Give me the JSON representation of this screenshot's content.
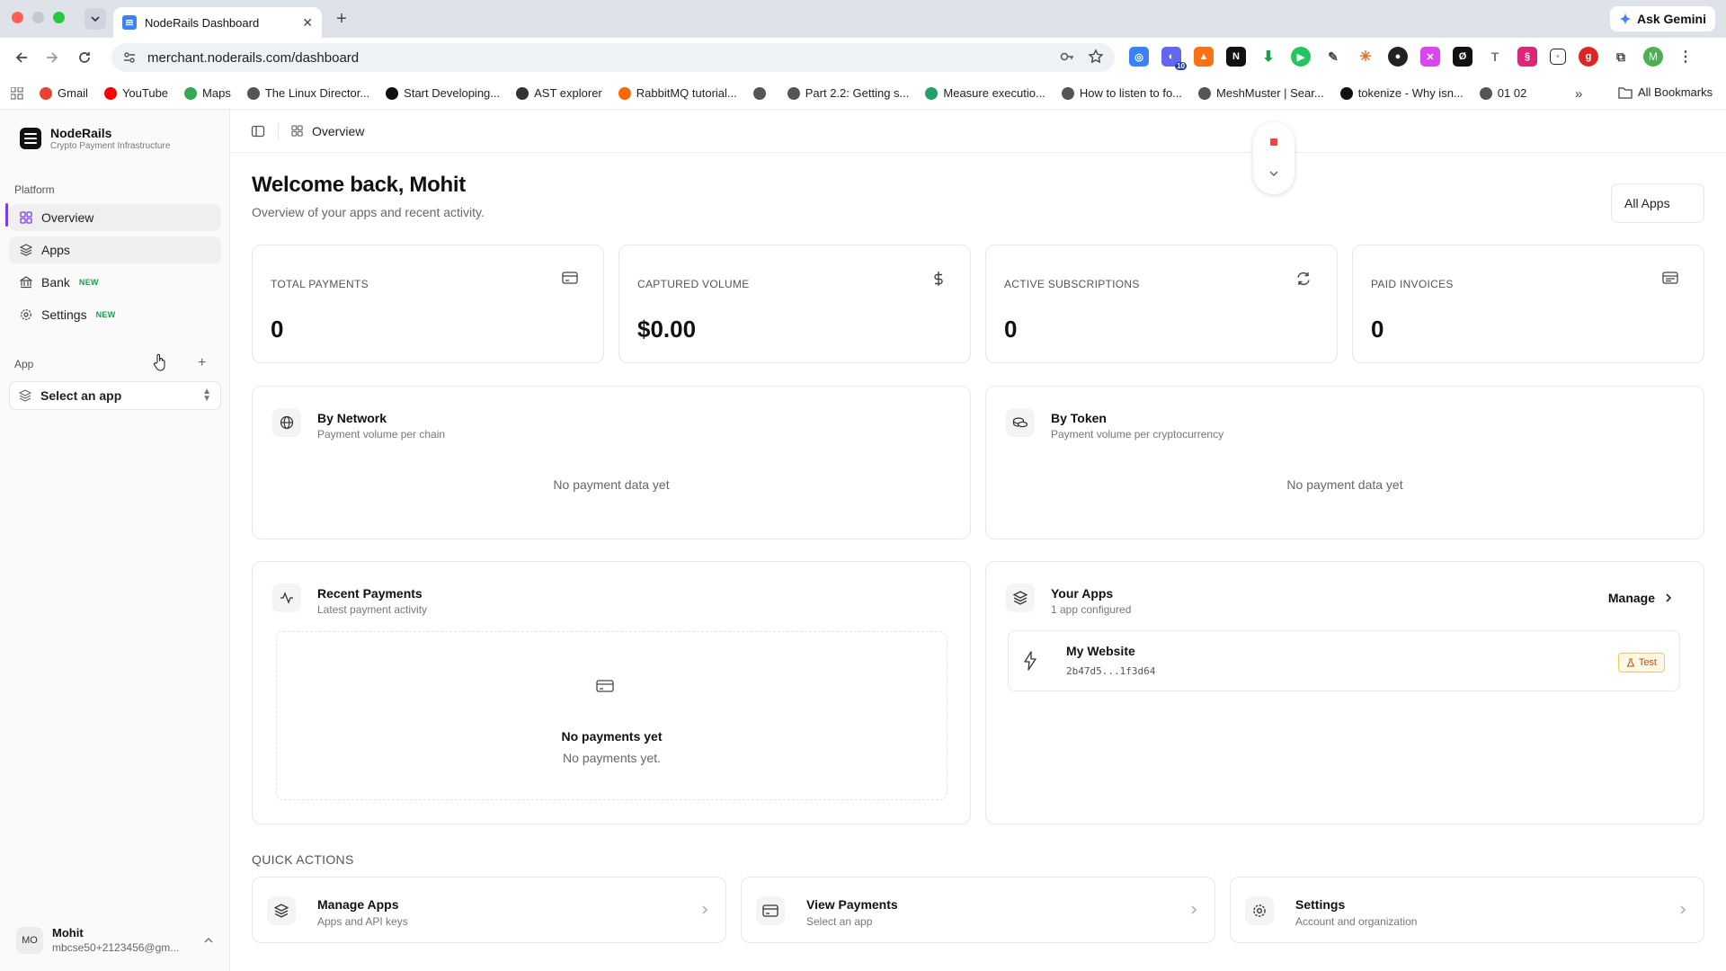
{
  "browser": {
    "tab_title": "NodeRails Dashboard",
    "url": "merchant.noderails.com/dashboard",
    "ask_gemini": "Ask Gemini",
    "profile_initial": "M",
    "bookmarks": [
      {
        "label": "Gmail",
        "color": "#ea4335"
      },
      {
        "label": "YouTube",
        "color": "#ff0000"
      },
      {
        "label": "Maps",
        "color": "#34a853"
      },
      {
        "label": "The Linux Director...",
        "color": "#555555"
      },
      {
        "label": "Start Developing...",
        "color": "#111111"
      },
      {
        "label": "AST explorer",
        "color": "#333333"
      },
      {
        "label": "RabbitMQ tutorial...",
        "color": "#ff6600"
      },
      {
        "label": "",
        "color": "#555555"
      },
      {
        "label": "Part 2.2: Getting s...",
        "color": "#555555"
      },
      {
        "label": "Measure executio...",
        "color": "#22a06b"
      },
      {
        "label": "How to listen to fo...",
        "color": "#555555"
      },
      {
        "label": "MeshMuster | Sear...",
        "color": "#555555"
      },
      {
        "label": "tokenize - Why isn...",
        "color": "#111111"
      },
      {
        "label": "01 02",
        "color": "#555555"
      }
    ],
    "all_bookmarks": "All Bookmarks",
    "extension_badge": "10"
  },
  "brand": {
    "name": "NodeRails",
    "tagline": "Crypto Payment Infrastructure"
  },
  "sidebar": {
    "section_platform": "Platform",
    "items": [
      {
        "label": "Overview",
        "badge": ""
      },
      {
        "label": "Apps",
        "badge": ""
      },
      {
        "label": "Bank",
        "badge": "NEW"
      },
      {
        "label": "Settings",
        "badge": "NEW"
      }
    ],
    "section_app": "App",
    "app_select_placeholder": "Select an app",
    "user": {
      "initials": "MO",
      "name": "Mohit",
      "email": "mbcse50+2123456@gm..."
    }
  },
  "header": {
    "breadcrumb": "Overview"
  },
  "main": {
    "welcome_title": "Welcome back, Mohit",
    "welcome_subtitle": "Overview of your apps and recent activity.",
    "filter_label": "All Apps",
    "stats": [
      {
        "label": "TOTAL PAYMENTS",
        "value": "0",
        "icon": "card-icon"
      },
      {
        "label": "CAPTURED VOLUME",
        "value": "$0.00",
        "icon": "dollar-icon"
      },
      {
        "label": "ACTIVE SUBSCRIPTIONS",
        "value": "0",
        "icon": "refresh-icon"
      },
      {
        "label": "PAID INVOICES",
        "value": "0",
        "icon": "receipt-icon"
      }
    ],
    "by_network": {
      "title": "By Network",
      "subtitle": "Payment volume per chain",
      "empty": "No payment data yet"
    },
    "by_token": {
      "title": "By Token",
      "subtitle": "Payment volume per cryptocurrency",
      "empty": "No payment data yet"
    },
    "recent_payments": {
      "title": "Recent Payments",
      "subtitle": "Latest payment activity",
      "empty_title": "No payments yet",
      "empty_subtitle": "No payments yet."
    },
    "your_apps": {
      "title": "Your Apps",
      "subtitle": "1 app configured",
      "manage": "Manage",
      "apps": [
        {
          "name": "My Website",
          "id": "2b47d5...1f3d64",
          "badge": "Test"
        }
      ]
    },
    "quick_actions_label": "QUICK ACTIONS",
    "quick_actions": [
      {
        "title": "Manage Apps",
        "subtitle": "Apps and API keys"
      },
      {
        "title": "View Payments",
        "subtitle": "Select an app"
      },
      {
        "title": "Settings",
        "subtitle": "Account and organization"
      }
    ]
  }
}
